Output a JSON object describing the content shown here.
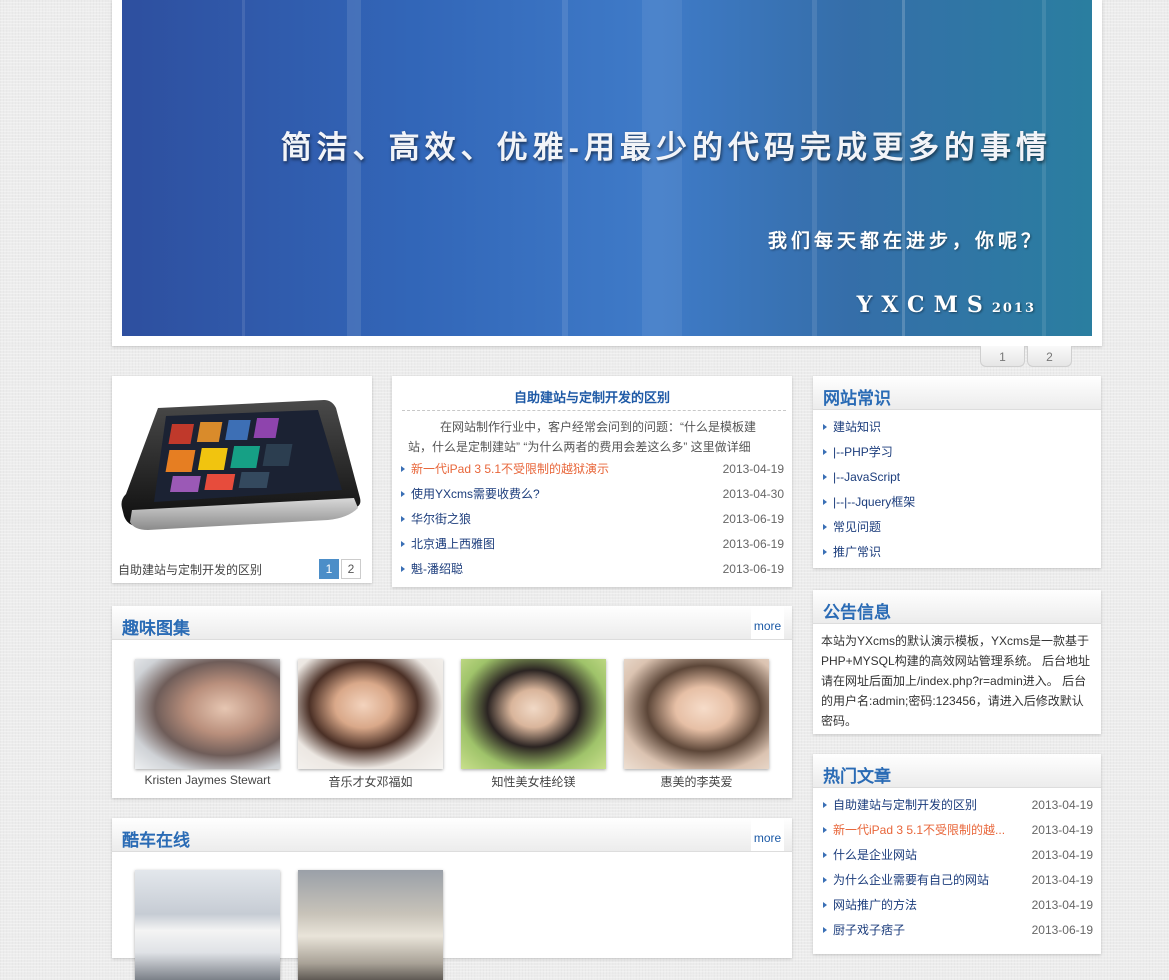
{
  "banner": {
    "title": "简洁、高效、优雅-用最少的代码完成更多的事情",
    "subtitle": "我们每天都在进步，你呢？",
    "brand": "YXCMS",
    "brand_year": "2013",
    "pages": [
      "1",
      "2"
    ]
  },
  "slideshow": {
    "caption": "自助建站与定制开发的区别",
    "pages": [
      "1",
      "2"
    ],
    "active_page": "1"
  },
  "news": {
    "headline": "自助建站与定制开发的区别",
    "summary": "在网站制作行业中，客户经常会问到的问题：“什么是模板建站，什么是定制建站” “为什么两者的费用会差这么多” 这里做详细",
    "items": [
      {
        "title": "新一代iPad 3 5.1不受限制的越狱演示",
        "date": "2013-04-19",
        "hot": true
      },
      {
        "title": "使用YXcms需要收费么?",
        "date": "2013-04-30",
        "hot": false
      },
      {
        "title": "华尔街之狼",
        "date": "2013-06-19",
        "hot": false
      },
      {
        "title": "北京遇上西雅图",
        "date": "2013-06-19",
        "hot": false
      },
      {
        "title": "魁-潘绍聪",
        "date": "2013-06-19",
        "hot": false
      }
    ]
  },
  "gallery": {
    "title": "趣味图集",
    "more": "more",
    "items": [
      {
        "caption": "Kristen Jaymes Stewart"
      },
      {
        "caption": "音乐才女邓福如"
      },
      {
        "caption": "知性美女桂纶镁"
      },
      {
        "caption": "惠美的李英爱"
      }
    ]
  },
  "cars": {
    "title": "酷车在线",
    "more": "more"
  },
  "knowledge": {
    "title": "网站常识",
    "items": [
      "建站知识",
      "|--PHP学习",
      "|--JavaScript",
      "|--|--Jquery框架",
      "常见问题",
      "推广常识"
    ]
  },
  "notice": {
    "title": "公告信息",
    "text": "本站为YXcms的默认演示模板，YXcms是一款基于PHP+MYSQL构建的高效网站管理系统。 后台地址请在网址后面加上/index.php?r=admin进入。 后台的用户名:admin;密码:123456，请进入后修改默认密码。"
  },
  "hot": {
    "title": "热门文章",
    "items": [
      {
        "title": "自助建站与定制开发的区别",
        "date": "2013-04-19",
        "hot": false
      },
      {
        "title": "新一代iPad 3 5.1不受限制的越...",
        "date": "2013-04-19",
        "hot": true
      },
      {
        "title": "什么是企业网站",
        "date": "2013-04-19",
        "hot": false
      },
      {
        "title": "为什么企业需要有自己的网站",
        "date": "2013-04-19",
        "hot": false
      },
      {
        "title": "网站推广的方法",
        "date": "2013-04-19",
        "hot": false
      },
      {
        "title": "厨子戏子痞子",
        "date": "2013-06-19",
        "hot": false
      }
    ]
  },
  "colors": {
    "accent": "#2a6bb5",
    "link": "#1c3d7c",
    "hot_link": "#e8663a",
    "banner_blue": "#3266b8"
  }
}
